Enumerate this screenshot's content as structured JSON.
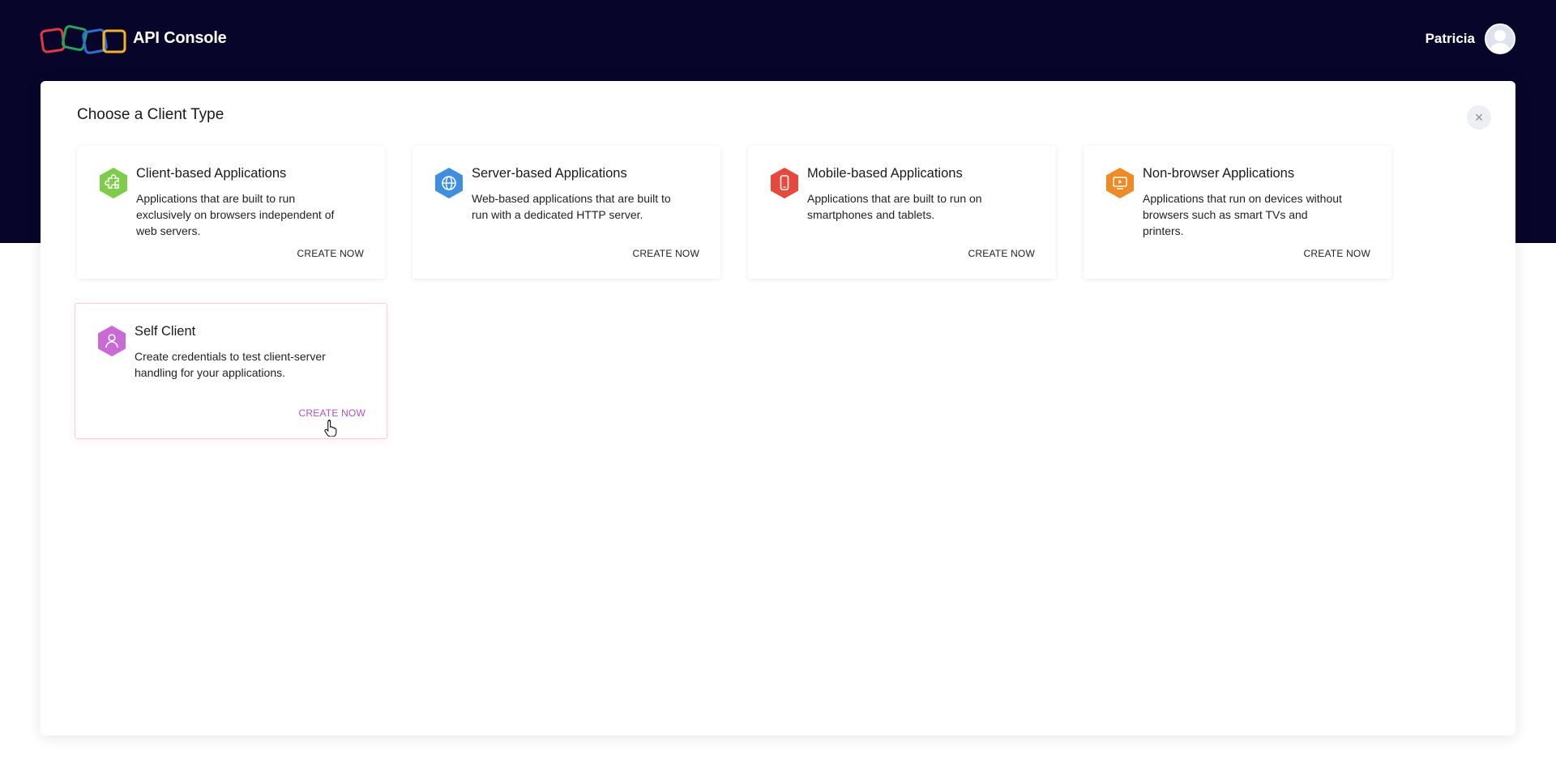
{
  "app": {
    "brand": "API Console",
    "user_name": "Patricia"
  },
  "dialog": {
    "title": "Choose a Client Type",
    "close_symbol": "×",
    "cards": [
      {
        "title": "Client-based Applications",
        "description": "Applications that are built to run exclusively on browsers independent of web servers.",
        "cta": "CREATE NOW",
        "icon": "puzzle-icon",
        "color": "#7dcc4a"
      },
      {
        "title": "Server-based Applications",
        "description": "Web-based applications that are built to run with a dedicated HTTP server.",
        "cta": "CREATE NOW",
        "icon": "globe-icon",
        "color": "#3f8fe0"
      },
      {
        "title": "Mobile-based Applications",
        "description": "Applications that are built to run on smartphones and tablets.",
        "cta": "CREATE NOW",
        "icon": "mobile-icon",
        "color": "#e8473c"
      },
      {
        "title": "Non-browser Applications",
        "description": "Applications that run on devices without browsers such as smart TVs and printers.",
        "cta": "CREATE NOW",
        "icon": "tv-icon",
        "color": "#f08a24"
      },
      {
        "title": "Self Client",
        "description": "Create credentials to test client-server handling for your applications.",
        "cta": "CREATE NOW",
        "icon": "person-icon",
        "color": "#c96ad6"
      }
    ]
  },
  "colors": {
    "header_bg": "#07052a",
    "logo_red": "#e2383f",
    "logo_green": "#22a55a",
    "logo_blue": "#2d6fd3",
    "logo_yellow": "#f5b323",
    "selected_cta": "#b34fbf"
  }
}
